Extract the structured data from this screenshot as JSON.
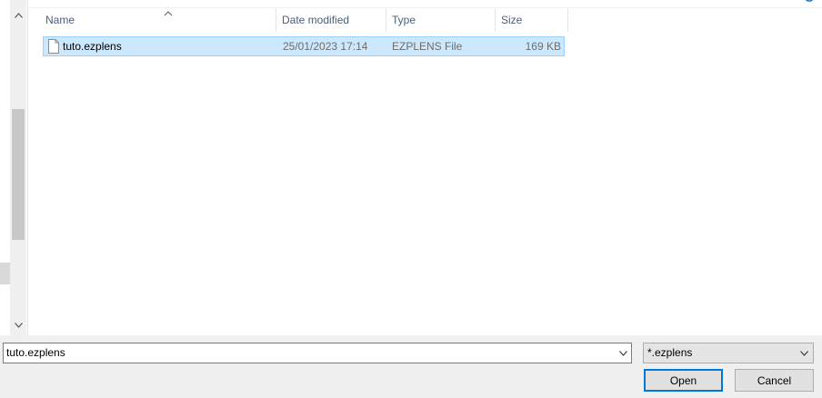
{
  "columns": {
    "name": "Name",
    "date_modified": "Date modified",
    "type": "Type",
    "size": "Size"
  },
  "files": [
    {
      "name": "tuto.ezplens",
      "date_modified": "25/01/2023 17:14",
      "type": "EZPLENS File",
      "size": "169 KB",
      "icon": "file-icon",
      "selected": true
    }
  ],
  "file_name_input": {
    "value": "tuto.ezplens"
  },
  "file_type_filter": {
    "selected": "*.ezplens"
  },
  "buttons": {
    "open": "Open",
    "cancel": "Cancel"
  },
  "colors": {
    "selection_bg": "#cce8ff",
    "selection_border": "#99d1ff",
    "default_button_border": "#0078d7",
    "header_text": "#4c607a"
  }
}
